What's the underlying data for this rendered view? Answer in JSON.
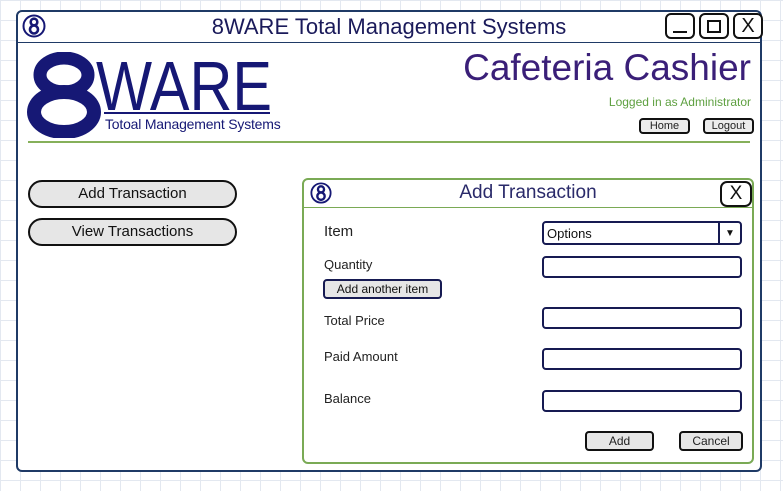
{
  "window": {
    "title": "8WARE Total Management Systems",
    "controls": {
      "minimize_icon": "minimize-icon",
      "maximize_icon": "maximize-icon",
      "close_label": "X"
    }
  },
  "brand": {
    "logo_number": "8",
    "logo_word": "WARE",
    "tagline": "Totoal Management Systems"
  },
  "header": {
    "app_title": "Cafeteria Cashier",
    "logged_in_text": "Logged in as Administrator",
    "home_label": "Home",
    "logout_label": "Logout"
  },
  "nav": {
    "add_transaction_label": "Add Transaction",
    "view_transactions_label": "View Transactions"
  },
  "dialog": {
    "title": "Add Transaction",
    "close_label": "X",
    "item_label": "Item",
    "item_select_value": "Options",
    "quantity_label": "Quantity",
    "quantity_value": "",
    "add_another_label": "Add another item",
    "total_price_label": "Total Price",
    "total_price_value": "",
    "paid_amount_label": "Paid Amount",
    "paid_amount_value": "",
    "balance_label": "Balance",
    "balance_value": "",
    "add_label": "Add",
    "cancel_label": "Cancel"
  },
  "colors": {
    "frame": "#1f3a66",
    "brand_blue": "#161875",
    "title_purple": "#3a1f78",
    "accent_green": "#86b05a",
    "logged_in_green": "#5ea040"
  }
}
